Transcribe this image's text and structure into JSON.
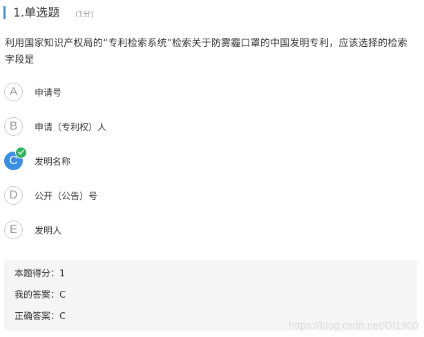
{
  "question": {
    "title": "1.单选题",
    "points": "(1分)",
    "text": "利用国家知识产权局的“专利检索系统”检索关于防雾霾口罩的中国发明专利，应该选择的检索字段是"
  },
  "options": [
    {
      "letter": "A",
      "label": "申请号"
    },
    {
      "letter": "B",
      "label": "申请（专利权）人"
    },
    {
      "letter": "C",
      "label": "发明名称"
    },
    {
      "letter": "D",
      "label": "公开（公告）号"
    },
    {
      "letter": "E",
      "label": "发明人"
    }
  ],
  "result": {
    "score_line": "本题得分：1",
    "my_answer_line": "我的答案：C",
    "correct_answer_line": "正确答案：C"
  },
  "watermark": "https://blog.csdn.net/GI1900",
  "colors": {
    "accent": "#3a8ee6",
    "correct_badge": "#2db45a",
    "result_bg": "#f5f5f5"
  },
  "icons": {
    "check": "check-icon"
  }
}
